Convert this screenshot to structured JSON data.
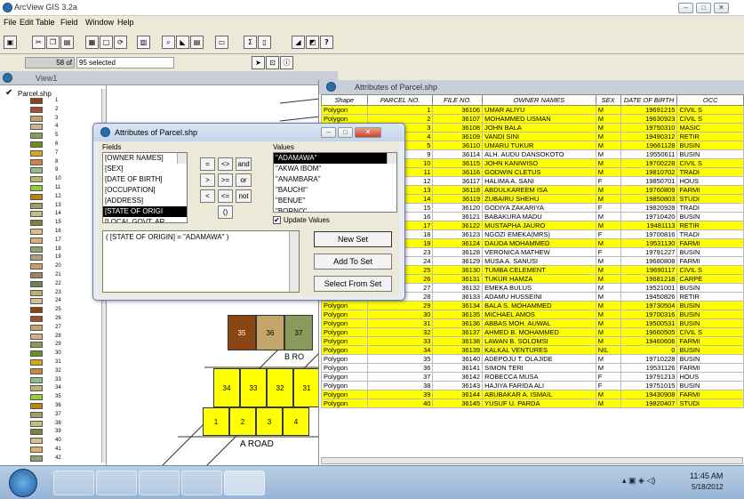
{
  "app": {
    "title": "ArcView GIS 3.2a"
  },
  "menu": [
    "File",
    "Edit",
    "Table",
    "Field",
    "Window",
    "Help"
  ],
  "status": {
    "count": "58",
    "of_label": "of",
    "selected": "95 selected"
  },
  "view": {
    "title": "View1",
    "layer": "Parcel.shp",
    "legend_values": [
      "1",
      "2",
      "3",
      "4",
      "5",
      "6",
      "7",
      "8",
      "9",
      "10",
      "11",
      "12",
      "13",
      "14",
      "15",
      "16",
      "17",
      "18",
      "19",
      "20",
      "21",
      "22",
      "23",
      "24",
      "25",
      "26",
      "27",
      "28",
      "29",
      "30",
      "31",
      "32",
      "33",
      "34",
      "35",
      "36",
      "37",
      "38",
      "39",
      "40",
      "41",
      "42"
    ]
  },
  "map": {
    "parcels_top": [
      "35",
      "36",
      "37"
    ],
    "parcels_mid": [
      "34",
      "33",
      "32",
      "31"
    ],
    "parcels_low": [
      "1",
      "2",
      "3",
      "4"
    ],
    "road_a": "A  ROAD",
    "road_b": "B   RO"
  },
  "attr": {
    "title": "Attributes of Parcel.shp",
    "columns": [
      "Shape",
      "PARCEL NO.",
      "FILE NO.",
      "OWNER NAMES",
      "SEX",
      "DATE OF BIRTH",
      "OCC"
    ],
    "rows": [
      {
        "sel": true,
        "c": [
          "Polygon",
          "1",
          "36106",
          "UMAR ALIYU",
          "M",
          "19691215",
          "CIVIL S"
        ]
      },
      {
        "sel": true,
        "c": [
          "Polygon",
          "2",
          "36107",
          "MOHAMMED USMAN",
          "M",
          "19630923",
          "CIVIL S"
        ]
      },
      {
        "sel": true,
        "c": [
          "Polygon",
          "3",
          "36108",
          "JOHN BALA",
          "M",
          "19750310",
          "MASIC"
        ]
      },
      {
        "sel": true,
        "c": [
          "Polygon",
          "4",
          "36109",
          "VANDI SINI",
          "M",
          "19490312",
          "RETIR"
        ]
      },
      {
        "sel": true,
        "c": [
          "Polygon",
          "5",
          "36110",
          "UMARU TUKUR",
          "M",
          "19661128",
          "BUSIN"
        ]
      },
      {
        "sel": false,
        "c": [
          "Polygon",
          "9",
          "36114",
          "ALH. AUDU DANSOKOTO",
          "M",
          "19550611",
          "BUSIN"
        ]
      },
      {
        "sel": true,
        "c": [
          "Polygon",
          "10",
          "36115",
          "JOHN KANIWISO",
          "M",
          "19700228",
          "CIVIL S"
        ]
      },
      {
        "sel": true,
        "c": [
          "Polygon",
          "11",
          "36116",
          "GODWIN CLETUS",
          "M",
          "19810702",
          "TRADI"
        ]
      },
      {
        "sel": false,
        "c": [
          "Polygon",
          "12",
          "36117",
          "HALIMA A. SANI",
          "F",
          "19850701",
          "HOUS"
        ]
      },
      {
        "sel": true,
        "c": [
          "Polygon",
          "13",
          "36118",
          "ABDULKAREEM ISA",
          "M",
          "19760809",
          "FARMI"
        ]
      },
      {
        "sel": true,
        "c": [
          "Polygon",
          "14",
          "36119",
          "ZUBAIRU SHEHU",
          "M",
          "19850803",
          "STUDI"
        ]
      },
      {
        "sel": false,
        "c": [
          "Polygon",
          "15",
          "36120",
          "GODIYA ZAKARIYA",
          "F",
          "19820928",
          "TRADI"
        ]
      },
      {
        "sel": false,
        "c": [
          "Polygon",
          "16",
          "36121",
          "BABAKURA MADU",
          "M",
          "19710420",
          "BUSIN"
        ]
      },
      {
        "sel": true,
        "c": [
          "Polygon",
          "17",
          "36122",
          "MUSTAPHA JAURO",
          "M",
          "19481113",
          "RETIR"
        ]
      },
      {
        "sel": false,
        "c": [
          "Polygon",
          "18",
          "36123",
          "NGOZI EMEKA(MRS)",
          "F",
          "19700816",
          "TRADI"
        ]
      },
      {
        "sel": true,
        "c": [
          "Polygon",
          "19",
          "36124",
          "DAUDA MOHAMMED",
          "M",
          "19531130",
          "FARMI"
        ]
      },
      {
        "sel": false,
        "c": [
          "Polygon",
          "23",
          "36128",
          "VERONICA MATHEW",
          "F",
          "19791227",
          "BUSIN"
        ]
      },
      {
        "sel": false,
        "c": [
          "Polygon",
          "24",
          "36129",
          "MUSA A. SANUSI",
          "M",
          "19680808",
          "FARMI"
        ]
      },
      {
        "sel": true,
        "c": [
          "Polygon",
          "25",
          "36130",
          "TUMBA CELEMENT",
          "M",
          "19690117",
          "CIVIL S"
        ]
      },
      {
        "sel": true,
        "c": [
          "Polygon",
          "26",
          "36131",
          "TUKUR HAMZA",
          "M",
          "19681218",
          "CARPE"
        ]
      },
      {
        "sel": false,
        "c": [
          "Polygon",
          "27",
          "36132",
          "EMEKA BULUS",
          "M",
          "19521001",
          "BUSIN"
        ]
      },
      {
        "sel": false,
        "c": [
          "Polygon",
          "28",
          "36133",
          "ADAMU HUSSEINI",
          "M",
          "19450826",
          "RETIR"
        ]
      },
      {
        "sel": true,
        "c": [
          "Polygon",
          "29",
          "36134",
          "BALA S. MOHAMMED",
          "M",
          "19730504",
          "BUSIN"
        ]
      },
      {
        "sel": true,
        "c": [
          "Polygon",
          "30",
          "36135",
          "MICHAEL AMOS",
          "M",
          "19700316",
          "BUSIN"
        ]
      },
      {
        "sel": true,
        "c": [
          "Polygon",
          "31",
          "36136",
          "ABBAS MOH. AUWAL",
          "M",
          "19500531",
          "BUSIN"
        ]
      },
      {
        "sel": true,
        "c": [
          "Polygon",
          "32",
          "36137",
          "AHMED B. MOHAMMED",
          "M",
          "19660505",
          "CIVIL S"
        ]
      },
      {
        "sel": true,
        "c": [
          "Polygon",
          "33",
          "36138",
          "LAWAN B. SOLOMSI",
          "M",
          "19460606",
          "FARMI"
        ]
      },
      {
        "sel": true,
        "c": [
          "Polygon",
          "34",
          "36139",
          "KALKAL VENTURES",
          "NIL",
          "0",
          "BUSIN"
        ]
      },
      {
        "sel": false,
        "c": [
          "Polygon",
          "35",
          "36140",
          "ADEPOJU T. OLAJIDE",
          "M",
          "19710228",
          "BUSIN"
        ]
      },
      {
        "sel": false,
        "c": [
          "Polygon",
          "36",
          "36141",
          "SIMON TERI",
          "M",
          "19531126",
          "FARMI"
        ]
      },
      {
        "sel": false,
        "c": [
          "Polygon",
          "37",
          "36142",
          "ROBECCA MUSA",
          "F",
          "19791213",
          "HOUS"
        ]
      },
      {
        "sel": false,
        "c": [
          "Polygon",
          "38",
          "36143",
          "HAJIYA FARIDA ALI",
          "F",
          "19751015",
          "BUSIN"
        ]
      },
      {
        "sel": true,
        "c": [
          "Polygon",
          "39",
          "36144",
          "ABUBAKAR A. ISMAIL",
          "M",
          "19430908",
          "FARMI"
        ]
      },
      {
        "sel": true,
        "c": [
          "Polygon",
          "40",
          "36145",
          "YUSUF U. PARDA",
          "M",
          "19820407",
          "STUDI"
        ]
      }
    ]
  },
  "query": {
    "title": "Attributes of Parcel.shp",
    "fields_label": "Fields",
    "values_label": "Values",
    "fields": [
      "[OWNER NAMES]",
      "[SEX]",
      "[DATE OF BIRTH]",
      "[OCCUPATION]",
      "[ADDRESS]",
      "[STATE OF ORIGI",
      "[LOCAL GOVT. AR"
    ],
    "fields_selected": 5,
    "values": [
      "\"ADAMAWA\"",
      "\"AKWA IBOM\"",
      "\"ANAMBARA\"",
      "\"BAUCHI\"",
      "\"BENUE\"",
      "\"BORNO\""
    ],
    "values_selected": 0,
    "operators": [
      "=",
      "<>",
      "and",
      ">",
      ">=",
      "or",
      "<",
      "<=",
      "not",
      "()"
    ],
    "update_values_label": "Update Values",
    "expression": "( [STATE OF ORIGIN] = \"ADAMAWA\" )",
    "new_set": "New Set",
    "add_to_set": "Add To Set",
    "select_from_set": "Select From Set"
  },
  "clock": {
    "time": "11:45 AM",
    "date": "5/18/2012"
  },
  "colors": {
    "selection": "#ffff00",
    "parcel_brown": "#8b4513",
    "parcel_tan": "#c5a46b",
    "parcel_green": "#8a9a5b"
  }
}
